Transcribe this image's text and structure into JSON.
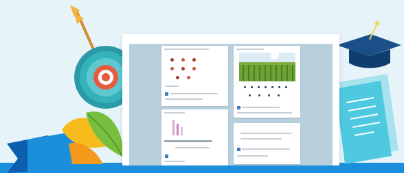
{
  "theme": {
    "background": "#e6f4fa",
    "panel": "#b8d0dd",
    "blue_band": "#1b8fdc",
    "ribbon_dark": "#0c5fae",
    "target_teal": "#34b3bd",
    "target_red": "#e65b3c",
    "leaf_green": "#78bf3f",
    "leaf_yellow": "#f6bb1d",
    "cap_navy": "#1a4f8a",
    "doc_teal": "#4ec9e0"
  },
  "icons": {
    "target": "target-with-arrow",
    "graduation_cap": "mortarboard",
    "documents": "paper-sheets",
    "plant": "leaves"
  },
  "cards": {
    "post_1": {
      "photo": "dot-pattern",
      "has_text_lines": true
    },
    "post_2": {
      "photo": "green-field-landscape",
      "has_text_lines": true
    },
    "post_3": {
      "photo": "bar-sketch",
      "has_text_lines": true
    },
    "post_4": {
      "photo": "none",
      "has_text_lines": true
    }
  }
}
